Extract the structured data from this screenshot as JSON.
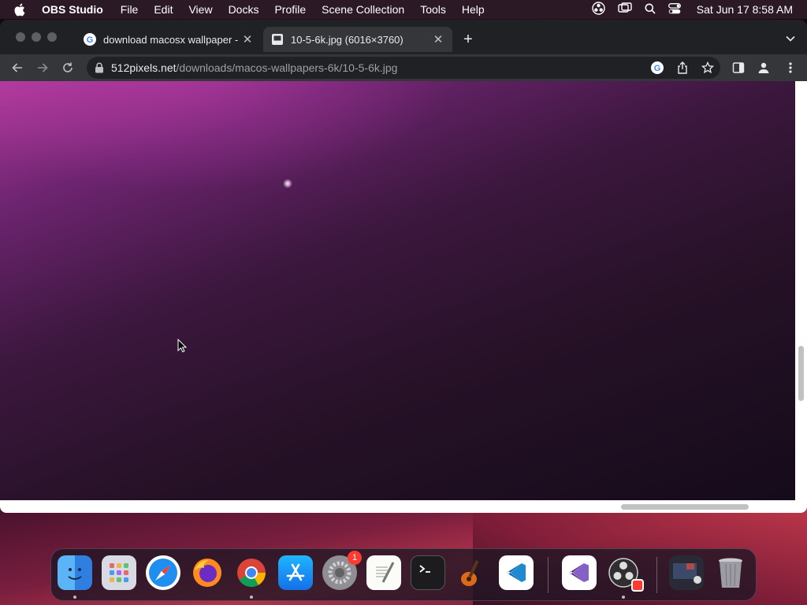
{
  "menubar": {
    "app_name": "OBS Studio",
    "items": [
      "File",
      "Edit",
      "View",
      "Docks",
      "Profile",
      "Scene Collection",
      "Tools",
      "Help"
    ],
    "clock": "Sat Jun 17  8:58 AM"
  },
  "browser": {
    "tabs": [
      {
        "title": "download macosx wallpaper - ",
        "active": false
      },
      {
        "title": "10-5-6k.jpg (6016×3760)",
        "active": true
      }
    ],
    "new_tab_label": "+",
    "url_host": "512pixels.net",
    "url_path": "/downloads/macos-wallpapers-6k/10-5-6k.jpg"
  },
  "dock": {
    "apps": [
      "Finder",
      "Launchpad",
      "Safari",
      "Firefox",
      "Chrome",
      "App Store",
      "System Settings",
      "TextEdit",
      "Terminal",
      "GarageBand",
      "VS Code",
      "Visual Studio",
      "OBS Studio",
      "Screenshot",
      "Trash"
    ],
    "settings_badge": "1"
  },
  "colors": {
    "menubar_bg": "#2b1a26",
    "browser_chrome": "#202124",
    "toolbar": "#35363a"
  }
}
